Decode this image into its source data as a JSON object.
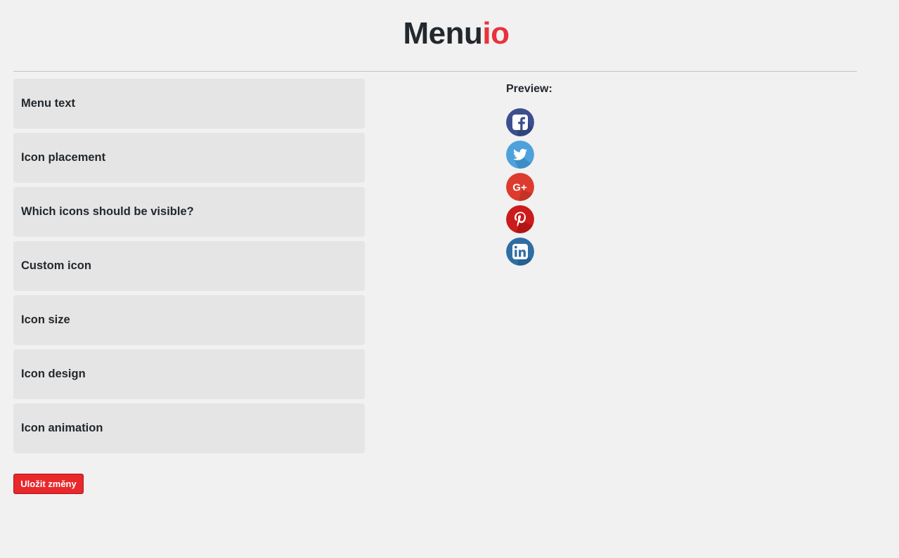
{
  "header": {
    "logo_main": "Menu",
    "logo_accent": "io"
  },
  "panels": [
    {
      "label": "Menu text"
    },
    {
      "label": "Icon placement"
    },
    {
      "label": "Which icons should be visible?"
    },
    {
      "label": "Custom icon"
    },
    {
      "label": "Icon size"
    },
    {
      "label": "Icon design"
    },
    {
      "label": "Icon animation"
    }
  ],
  "actions": {
    "save_label": "Uložit změny"
  },
  "preview": {
    "label": "Preview:",
    "icons": [
      {
        "name": "facebook-icon",
        "color": "#3b4f8f"
      },
      {
        "name": "twitter-icon",
        "color": "#4ea1db"
      },
      {
        "name": "google-plus-icon",
        "color": "#dc3b2d"
      },
      {
        "name": "pinterest-icon",
        "color": "#cb1b1b"
      },
      {
        "name": "linkedin-icon",
        "color": "#2f6ea3"
      }
    ]
  },
  "colors": {
    "accent": "#e8323c",
    "button": "#e8282b",
    "panel_bg": "#e5e5e5",
    "page_bg": "#f1f1f1"
  }
}
